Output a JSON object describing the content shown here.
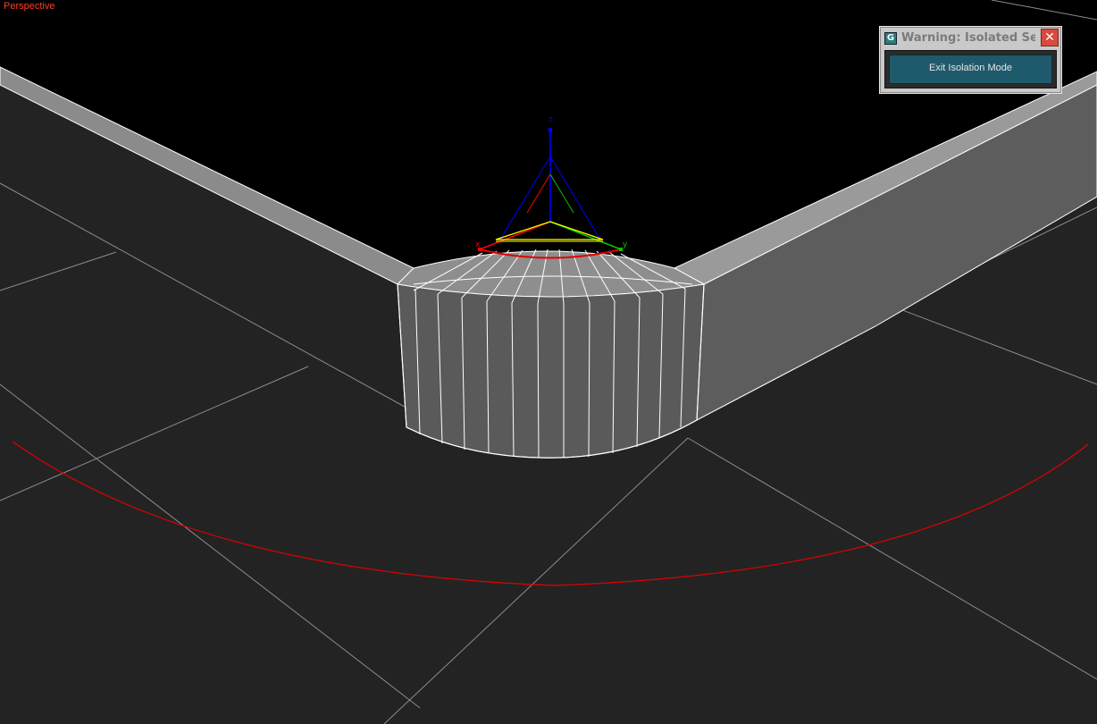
{
  "viewport": {
    "label": "Perspective",
    "label_color": "#ff3a2a",
    "background": "#000000",
    "ground_color": "#232323",
    "grid_color": "#8c8c8c",
    "wire_color": "#ffffff",
    "selection_circle_color": "#e00000"
  },
  "gizmo": {
    "axis_z": "z",
    "axis_x": "x",
    "axis_y": "y",
    "x_color": "#ff0000",
    "y_color": "#00c800",
    "z_color": "#0000ff",
    "plane_color": "#ffff00"
  },
  "dialog": {
    "icon": "app-logo-icon",
    "icon_glyph": "G",
    "title": "Warning: Isolated Sel...",
    "close_icon": "close-icon",
    "close_glyph": "✕",
    "button_label": "Exit Isolation Mode",
    "button_color": "#1f5a6c"
  }
}
